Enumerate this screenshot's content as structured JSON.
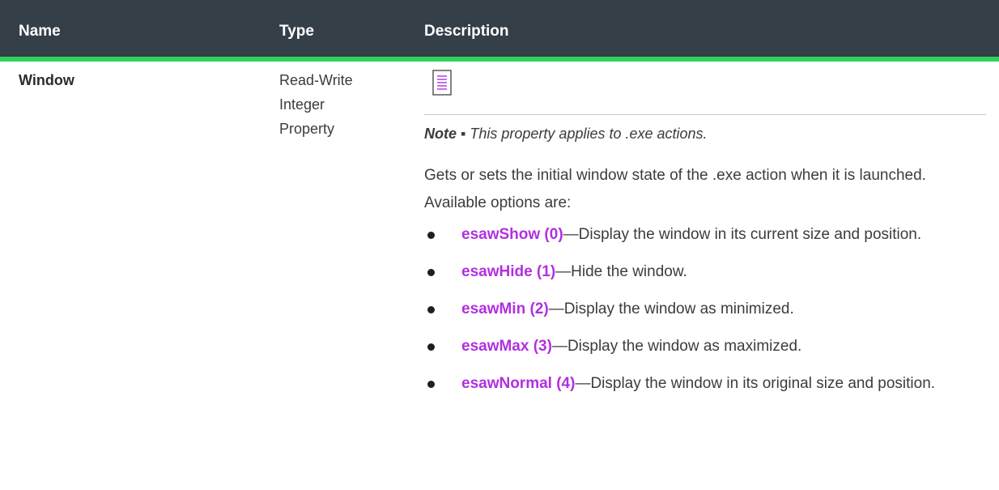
{
  "table": {
    "headers": {
      "name": "Name",
      "type": "Type",
      "description": "Description"
    },
    "colors": {
      "header_bg": "#353f48",
      "header_accent": "#2ed35a",
      "link": "#b22fe0"
    },
    "row": {
      "name": "Window",
      "type_lines": [
        "Read-Write",
        "Integer",
        "Property"
      ],
      "note_icon": "note-icon",
      "note_label": "Note",
      "note_separator": " ▪ ",
      "note_text": "This property applies to .exe actions.",
      "paragraph": "Gets or sets the initial window state of the .exe action when it is launched. Available options are:",
      "options": [
        {
          "label": "esawShow (0)",
          "text": "—Display the window in its current size and position."
        },
        {
          "label": "esawHide (1)",
          "text": "—Hide the window."
        },
        {
          "label": "esawMin (2)",
          "text": "—Display the window as minimized."
        },
        {
          "label": "esawMax (3)",
          "text": "—Display the window as maximized."
        },
        {
          "label": "esawNormal (4)",
          "text": "—Display the window in its original size and position."
        }
      ]
    }
  }
}
